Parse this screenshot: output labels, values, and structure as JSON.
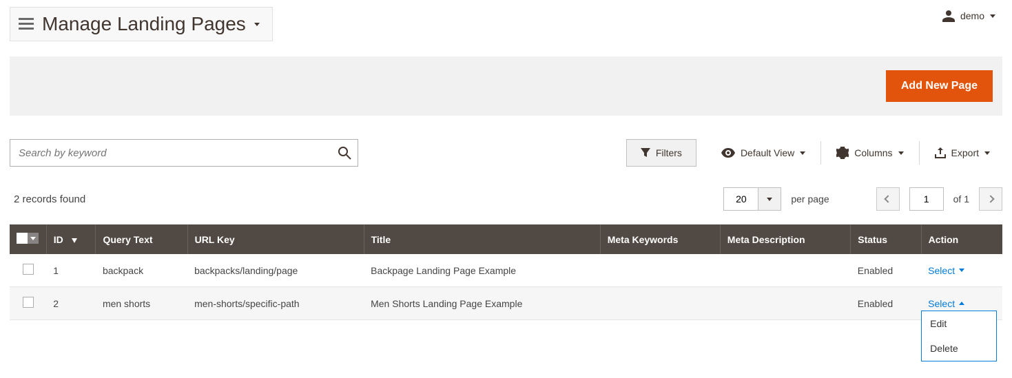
{
  "header": {
    "title": "Manage Landing Pages",
    "user_name": "demo"
  },
  "action_bar": {
    "add_button": "Add New Page"
  },
  "search": {
    "placeholder": "Search by keyword"
  },
  "toolbar": {
    "filters": "Filters",
    "default_view": "Default View",
    "columns": "Columns",
    "export": "Export"
  },
  "pagination": {
    "records_found": "2 records found",
    "page_size": "20",
    "per_page_label": "per page",
    "current_page": "1",
    "of_label": "of 1"
  },
  "columns": {
    "id": "ID",
    "query_text": "Query Text",
    "url_key": "URL Key",
    "title": "Title",
    "meta_keywords": "Meta Keywords",
    "meta_description": "Meta Description",
    "status": "Status",
    "action": "Action"
  },
  "rows": [
    {
      "id": "1",
      "query": "backpack",
      "url": "backpacks/landing/page",
      "title": "Backpage Landing Page Example",
      "mk": "",
      "md": "",
      "status": "Enabled",
      "action": "Select"
    },
    {
      "id": "2",
      "query": "men shorts",
      "url": "men-shorts/specific-path",
      "title": "Men Shorts Landing Page Example",
      "mk": "",
      "md": "",
      "status": "Enabled",
      "action": "Select"
    }
  ],
  "dropdown": {
    "edit": "Edit",
    "delete": "Delete"
  }
}
